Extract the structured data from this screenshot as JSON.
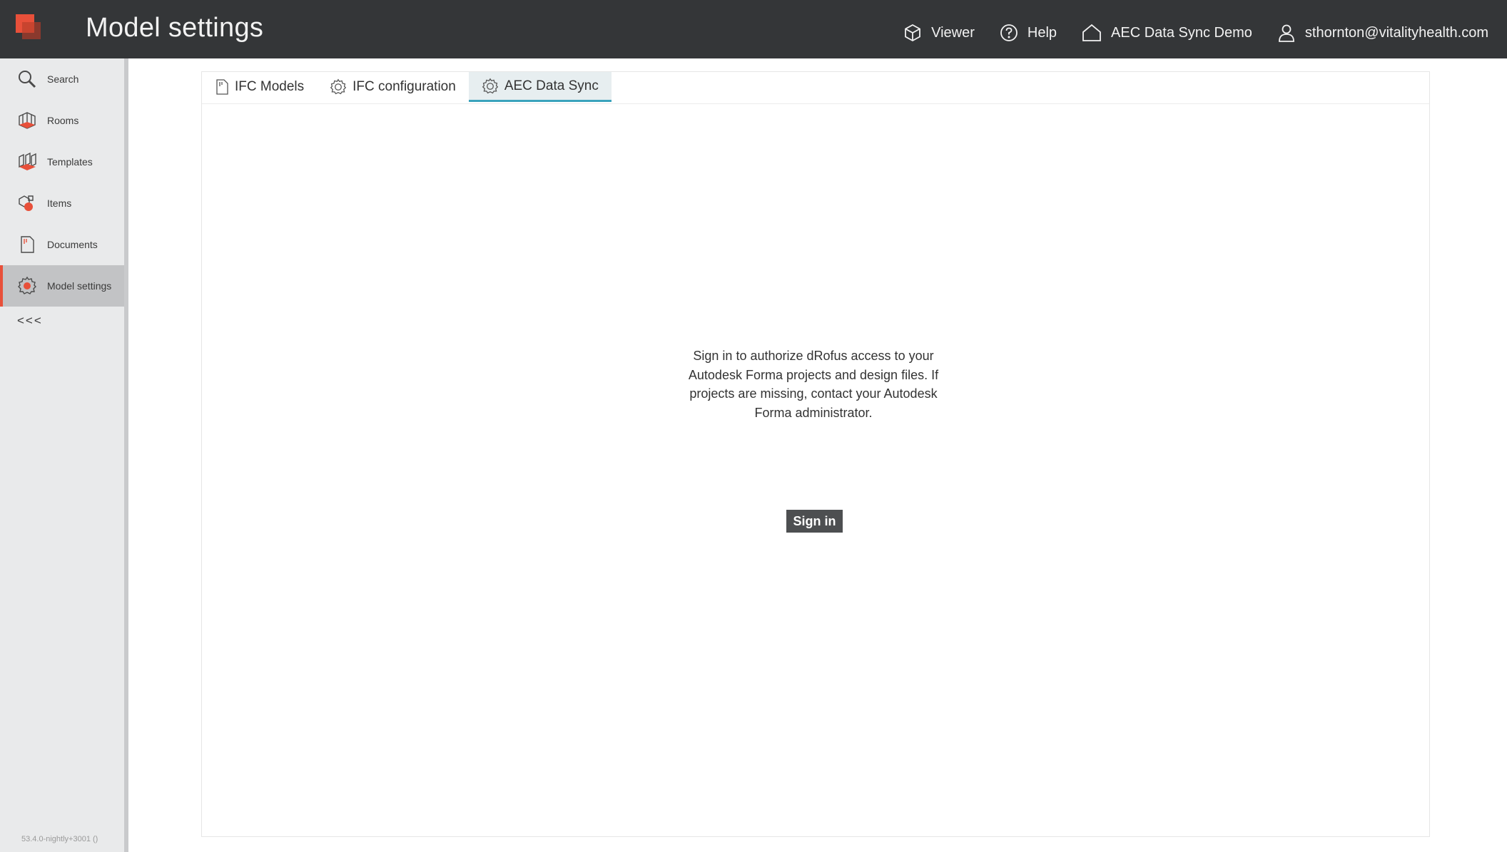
{
  "header": {
    "title": "Model settings",
    "viewer_label": "Viewer",
    "help_label": "Help",
    "project_label": "AEC Data Sync Demo",
    "user_label": "sthornton@vitalityhealth.com"
  },
  "sidebar": {
    "items": [
      {
        "label": "Search",
        "icon": "search-icon"
      },
      {
        "label": "Rooms",
        "icon": "rooms-icon"
      },
      {
        "label": "Templates",
        "icon": "templates-icon"
      },
      {
        "label": "Items",
        "icon": "items-icon"
      },
      {
        "label": "Documents",
        "icon": "documents-icon"
      },
      {
        "label": "Model settings",
        "icon": "gear-icon",
        "active": true
      }
    ],
    "collapse_label": "<<<",
    "version": "53.4.0-nightly+3001 ()"
  },
  "tabs": [
    {
      "label": "IFC Models",
      "icon": "document-icon"
    },
    {
      "label": "IFC configuration",
      "icon": "gear-icon"
    },
    {
      "label": "AEC Data Sync",
      "icon": "gear-icon",
      "active": true
    }
  ],
  "main": {
    "message": "Sign in to authorize dRofus access to your Autodesk Forma projects and design files. If projects are missing, contact your Autodesk Forma administrator.",
    "signin_label": "Sign in"
  },
  "colors": {
    "topbar": "#343638",
    "accent": "#e8503a",
    "tab_active": "#3aa3bc",
    "button": "#4d4f51"
  }
}
